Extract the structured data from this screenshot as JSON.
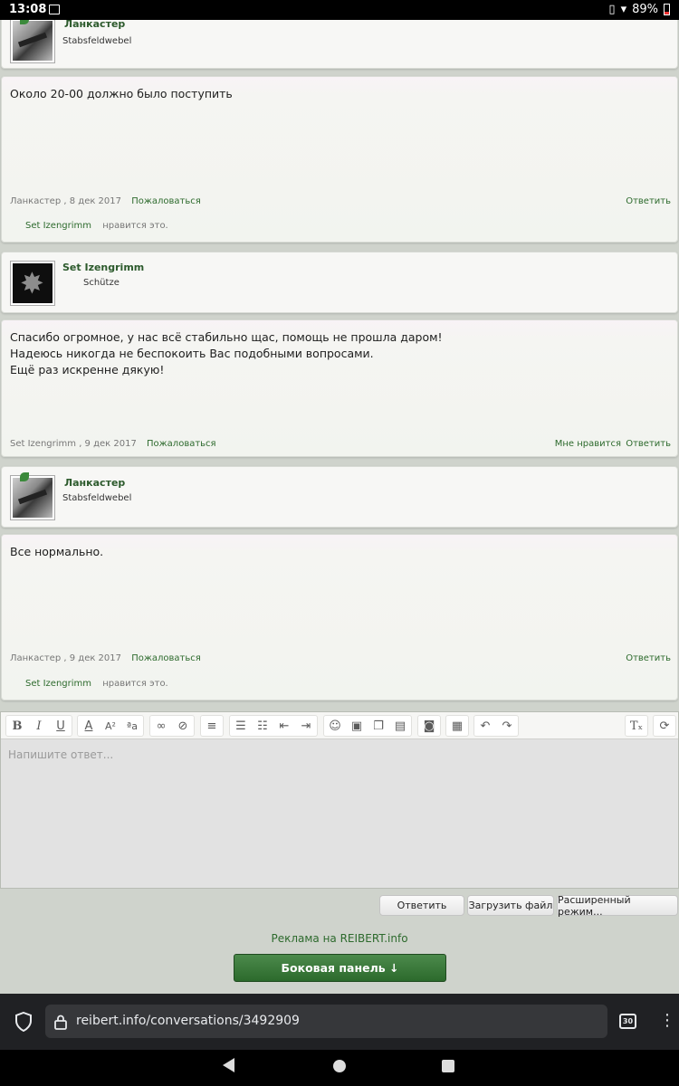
{
  "status": {
    "time": "13:08",
    "battery": "89%"
  },
  "posts": [
    {
      "author": "Ланкастер",
      "rank": "Stabsfeldwebel"
    },
    {
      "text": [
        "Около 20-00 должно было поступить"
      ],
      "author": "Ланкастер",
      "date": ", 8 дек 2017",
      "report": "Пожаловаться",
      "reply": "Ответить",
      "liker": "Set Izengrimm",
      "likes_suffix": "нравится это."
    },
    {
      "author": "Set Izengrimm",
      "rank": "Schütze"
    },
    {
      "text": [
        "Спасибо огромное, у нас всё стабильно щас, помощь не прошла даром!",
        "Надеюсь никогда не беспокоить Вас подобными вопросами.",
        "Ещё раз искренне дякую!"
      ],
      "author": "Set Izengrimm",
      "date": ", 9 дек 2017",
      "report": "Пожаловаться",
      "like": "Мне нравится",
      "reply": "Ответить"
    },
    {
      "author": "Ланкастер",
      "rank": "Stabsfeldwebel"
    },
    {
      "text": [
        "Все нормально."
      ],
      "author": "Ланкастер",
      "date": ", 9 дек 2017",
      "report": "Пожаловаться",
      "reply": "Ответить",
      "liker": "Set Izengrimm",
      "likes_suffix": "нравится это."
    }
  ],
  "editor": {
    "placeholder": "Напишите ответ..."
  },
  "buttons": {
    "reply": "Ответить",
    "upload": "Загрузить файл",
    "advanced": "Расширенный режим..."
  },
  "ad_link": "Реклама на REIBERT.info",
  "sidebar_button": "Боковая панель ↓",
  "browser": {
    "url": "reibert.info/conversations/3492909",
    "tab_count": "30"
  }
}
